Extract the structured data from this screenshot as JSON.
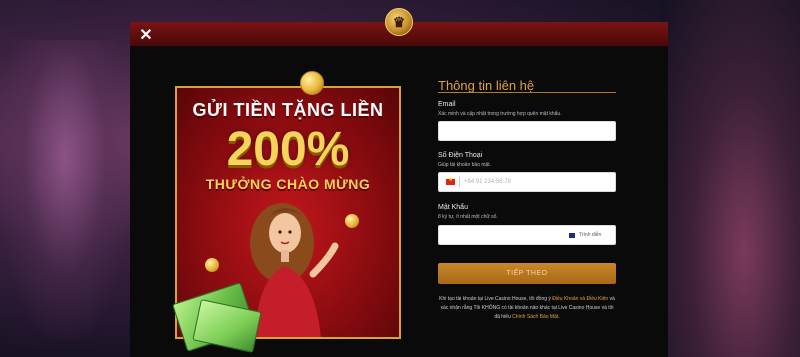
{
  "promo": {
    "line1": "GỬI TIỀN TẶNG LIỀN",
    "percent": "200%",
    "line2": "THƯỞNG CHÀO MỪNG"
  },
  "form": {
    "title": "Thông tin liên hệ",
    "email": {
      "label": "Email",
      "hint": "Xác minh và cập nhật trong trường hợp quên mật khẩu.",
      "value": ""
    },
    "phone": {
      "label": "Số Điện Thoại",
      "hint": "Giúp tài khoản bảo mật.",
      "placeholder": "+84 91 234 56 78"
    },
    "password": {
      "label": "Mật Khẩu",
      "hint": "8 ký tự, ít nhất một chữ số.",
      "toggle_label": "Trình diễn"
    },
    "submit_label": "TIẾP THEO",
    "terms": {
      "part1": "Khi tạo tài khoản tại Live Casino House, tôi đồng ý ",
      "link1": "Điều Khoản và Điều Kiện",
      "part2": " và xác nhận rằng Tôi KHÔNG có tài khoản nào khác tại Live Casino House và tôi đã hiểu ",
      "link2": "Chính Sách Bảo Mật",
      "part3": "."
    }
  },
  "colors": {
    "accent": "#e3a13c",
    "header_red": "#7a1414",
    "button": "#c9882a"
  }
}
